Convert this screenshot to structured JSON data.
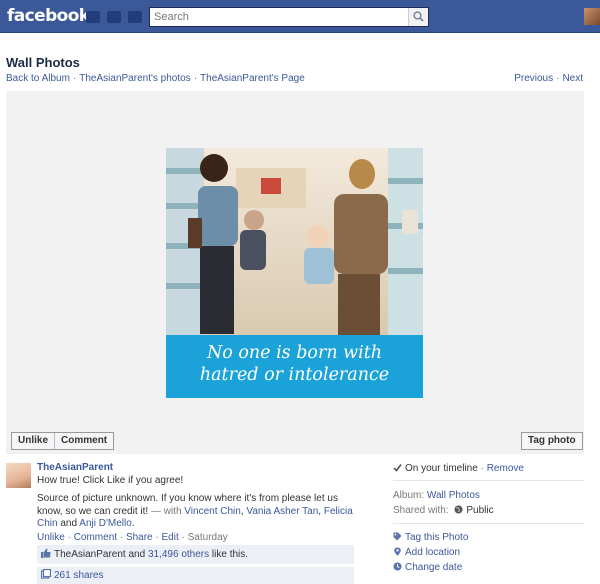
{
  "header": {
    "logo": "facebook",
    "search_placeholder": "Search"
  },
  "page": {
    "title": "Wall Photos",
    "breadcrumbs": [
      "Back to Album",
      "TheAsianParent's photos",
      "TheAsianParent's Page"
    ],
    "pager": {
      "previous": "Previous",
      "next": "Next"
    }
  },
  "photo": {
    "caption_line1": "No one is born with",
    "caption_line2": "hatred or intolerance",
    "band_color": "#1ba3d9"
  },
  "photo_actions": {
    "unlike": "Unlike",
    "comment": "Comment",
    "tag_photo": "Tag photo"
  },
  "post": {
    "author": "TheAsianParent",
    "text": "How true! Click Like if you agree!",
    "source_prefix": "Source of picture unknown. If you know where it's from please let us know, so we can credit it!",
    "with_label": " — with ",
    "tagged": [
      "Vincent Chin",
      "Vania Asher Tan",
      "Felicia Chin",
      "Anji D'Mello"
    ],
    "actions": {
      "unlike": "Unlike",
      "comment": "Comment",
      "share": "Share",
      "edit": "Edit",
      "time": "Saturday"
    },
    "likes": {
      "name": "TheAsianParent",
      "and": " and ",
      "others": "31,496 others",
      "suffix": " like this."
    },
    "shares": "261 shares"
  },
  "sidebar": {
    "timeline": "On your timeline",
    "remove": "Remove",
    "album_label": "Album:",
    "album_value": "Wall Photos",
    "shared_label": "Shared with:",
    "shared_value": "Public",
    "links": [
      "Tag this Photo",
      "Add location",
      "Change date"
    ]
  },
  "colors": {
    "brand": "#3b5998",
    "link": "#3b5998",
    "stage": "#f2f2f2"
  }
}
